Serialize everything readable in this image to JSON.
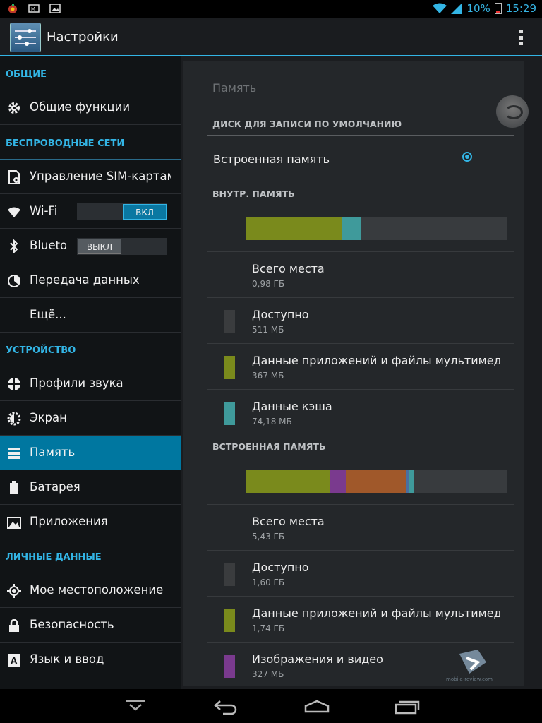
{
  "status_bar": {
    "battery_percent": "10%",
    "time": "15:29",
    "icons": [
      "game-app-icon",
      "photo-app-icon",
      "gallery-icon",
      "wifi-icon",
      "signal-icon",
      "battery-icon"
    ]
  },
  "action_bar": {
    "title": "Настройки",
    "app_icon": "settings-sliders-icon",
    "overflow_icon": "overflow-menu-icon"
  },
  "sidebar": {
    "sections": [
      {
        "header": "ОБЩИЕ",
        "items": [
          {
            "label": "Общие функции",
            "icon": "gear-icon"
          }
        ]
      },
      {
        "header": "БЕСПРОВОДНЫЕ СЕТИ",
        "items": [
          {
            "label": "Управление SIM-картами",
            "icon": "sim-card-icon"
          },
          {
            "label": "Wi-Fi",
            "icon": "wifi-icon",
            "toggle": "ВКЛ",
            "toggle_state": "on"
          },
          {
            "label": "Bluetooth",
            "icon": "bluetooth-icon",
            "toggle": "ВЫКЛ",
            "toggle_state": "off"
          },
          {
            "label": "Передача данных",
            "icon": "data-usage-icon"
          },
          {
            "label": "Ещё...",
            "icon": ""
          }
        ]
      },
      {
        "header": "УСТРОЙСТВО",
        "items": [
          {
            "label": "Профили звука",
            "icon": "sound-profile-icon"
          },
          {
            "label": "Экран",
            "icon": "display-icon"
          },
          {
            "label": "Память",
            "icon": "storage-icon",
            "active": true
          },
          {
            "label": "Батарея",
            "icon": "battery-icon"
          },
          {
            "label": "Приложения",
            "icon": "apps-icon"
          }
        ]
      },
      {
        "header": "ЛИЧНЫЕ ДАННЫЕ",
        "items": [
          {
            "label": "Мое местоположение",
            "icon": "location-icon"
          },
          {
            "label": "Безопасность",
            "icon": "lock-icon"
          },
          {
            "label": "Язык и ввод",
            "icon": "language-icon"
          }
        ]
      }
    ]
  },
  "storage_panel": {
    "title": "Память",
    "default_disk_header": "ДИСК ДЛЯ ЗАПИСИ ПО УМОЛЧАНИЮ",
    "default_disk_option": "Встроенная память",
    "internal": {
      "header": "ВНУТР. ПАМЯТЬ",
      "usage_bar": [
        {
          "fraction": 0.365,
          "color": "#7a8a1c"
        },
        {
          "fraction": 0.074,
          "color": "#3f9a9b"
        }
      ],
      "entries": [
        {
          "name": "Всего места",
          "value": "0,98 ГБ",
          "color": ""
        },
        {
          "name": "Доступно",
          "value": "511 МБ",
          "color": "#3a3c3e"
        },
        {
          "name": "Данные приложений и файлы мультимедиа",
          "value": "367 МБ",
          "color": "#7a8a1c"
        },
        {
          "name": "Данные кэша",
          "value": "74,18 МБ",
          "color": "#3f9a9b"
        }
      ]
    },
    "builtin": {
      "header": "ВСТРОЕННАЯ ПАМЯТЬ",
      "usage_bar": [
        {
          "fraction": 0.32,
          "color": "#7a8a1c"
        },
        {
          "fraction": 0.06,
          "color": "#7a3a8e"
        },
        {
          "fraction": 0.23,
          "color": "#a0582a"
        },
        {
          "fraction": 0.014,
          "color": "#4a6fa0"
        },
        {
          "fraction": 0.016,
          "color": "#3f9a9b"
        }
      ],
      "entries": [
        {
          "name": "Всего места",
          "value": "5,43 ГБ",
          "color": ""
        },
        {
          "name": "Доступно",
          "value": "1,60 ГБ",
          "color": "#3a3c3e"
        },
        {
          "name": "Данные приложений и файлы мультимедиа",
          "value": "1,74 ГБ",
          "color": "#7a8a1c"
        },
        {
          "name": "Изображения и видео",
          "value": "327 МБ",
          "color": "#7a3a8e"
        }
      ]
    }
  },
  "watermark": "mobile-review.com",
  "nav_bar": [
    "hide-keyboard-icon",
    "back-icon",
    "home-icon",
    "recent-apps-icon"
  ]
}
